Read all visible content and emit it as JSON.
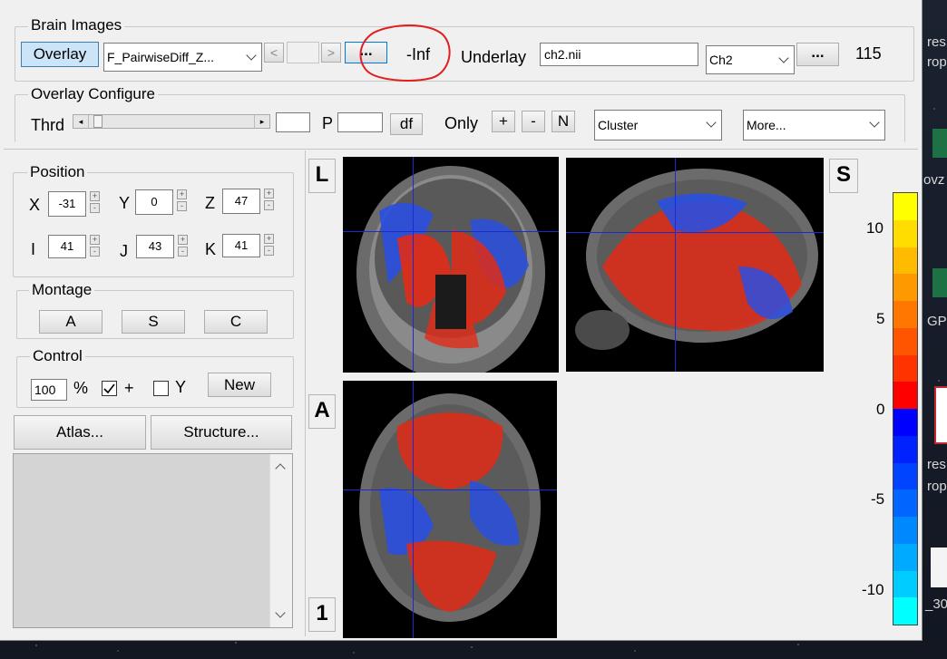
{
  "brain_images": {
    "title": "Brain Images",
    "overlay_button": "Overlay",
    "overlay_file": "F_PairwiseDiff_Z...",
    "prev_label": "<",
    "next_label": ">",
    "browse_label": "...",
    "overlay_min": "-Inf",
    "underlay_label": "Underlay",
    "underlay_file": "ch2.nii",
    "underlay_select": "Ch2",
    "underlay_browse": "...",
    "underlay_max": "115"
  },
  "overlay_configure": {
    "title": "Overlay Configure",
    "thrd_label": "Thrd",
    "p_label": "P",
    "df_button": "df",
    "only_label": "Only",
    "plus_button": "+",
    "minus_button": "-",
    "n_button": "N",
    "cluster_select": "Cluster",
    "more_select": "More..."
  },
  "position": {
    "title": "Position",
    "x_label": "X",
    "x_value": "-31",
    "y_label": "Y",
    "y_value": "0",
    "z_label": "Z",
    "z_value": "47",
    "i_label": "I",
    "i_value": "41",
    "j_label": "J",
    "j_value": "43",
    "k_label": "K",
    "k_value": "41"
  },
  "montage": {
    "title": "Montage",
    "a_button": "A",
    "s_button": "S",
    "c_button": "C"
  },
  "control": {
    "title": "Control",
    "zoom_value": "100",
    "percent_label": "%",
    "plus_label": "+",
    "y_label": "Y",
    "new_button": "New"
  },
  "atlas_button": "Atlas...",
  "structure_button": "Structure...",
  "view_labels": {
    "coronal": "L",
    "sagittal": "S",
    "axial": "A",
    "index": "1"
  },
  "colorbar": {
    "ticks": [
      "10",
      "5",
      "0",
      "-5",
      "-10"
    ],
    "colors_positive": [
      "#ffff00",
      "#ffdd00",
      "#ffbb00",
      "#ff9900",
      "#ff7700",
      "#ff5500",
      "#ff3300",
      "#ff0000"
    ],
    "colors_negative": [
      "#0000ff",
      "#0022ff",
      "#0044ff",
      "#0066ff",
      "#0088ff",
      "#00aaff",
      "#00ccff",
      "#00ffff"
    ]
  },
  "side_fragments": {
    "t1": "res",
    "t2": "rop",
    "t3": "ovz",
    "t4": "GP",
    "t5": "res",
    "t6": "rop",
    "t7": "_30"
  }
}
